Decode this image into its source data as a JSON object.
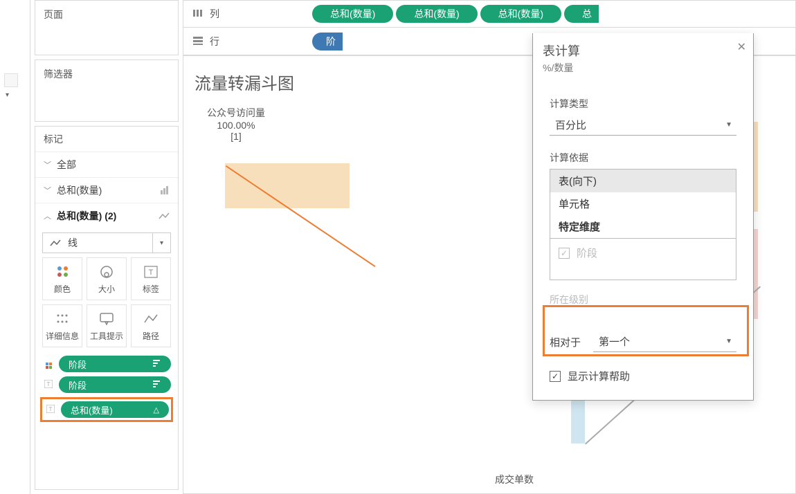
{
  "shelves": {
    "columns_label": "列",
    "rows_label": "行",
    "column_pills": [
      "总和(数量)",
      "总和(数量)",
      "总和(数量)",
      "总"
    ],
    "row_pill": "阶"
  },
  "panels": {
    "pages": "页面",
    "filters": "筛选器",
    "marks": "标记"
  },
  "marks": {
    "all": "全部",
    "sum1": "总和(数量)",
    "sum2": "总和(数量) (2)",
    "type_label": "线",
    "cells": {
      "color": "颜色",
      "size": "大小",
      "label": "标签",
      "detail": "详细信息",
      "tooltip": "工具提示",
      "path": "路径"
    },
    "pills": {
      "phase1": "阶段",
      "phase2": "阶段",
      "sum": "总和(数量)"
    }
  },
  "chart": {
    "title": "流量转漏斗图",
    "col1_header": "公众号访问量",
    "col1_pct": "100.00%",
    "col1_idx": "[1]",
    "footer_label": "成交单数"
  },
  "popup": {
    "title": "表计算",
    "subtitle": "%/数量",
    "calc_type_label": "计算类型",
    "calc_type_value": "百分比",
    "compute_using_label": "计算依据",
    "list": {
      "table_down": "表(向下)",
      "cell": "单元格",
      "specific": "特定维度"
    },
    "dim_checkbox": "阶段",
    "at_level_label": "所在级别",
    "relative_to_label": "相对于",
    "relative_to_value": "第一个",
    "show_help": "显示计算帮助"
  }
}
